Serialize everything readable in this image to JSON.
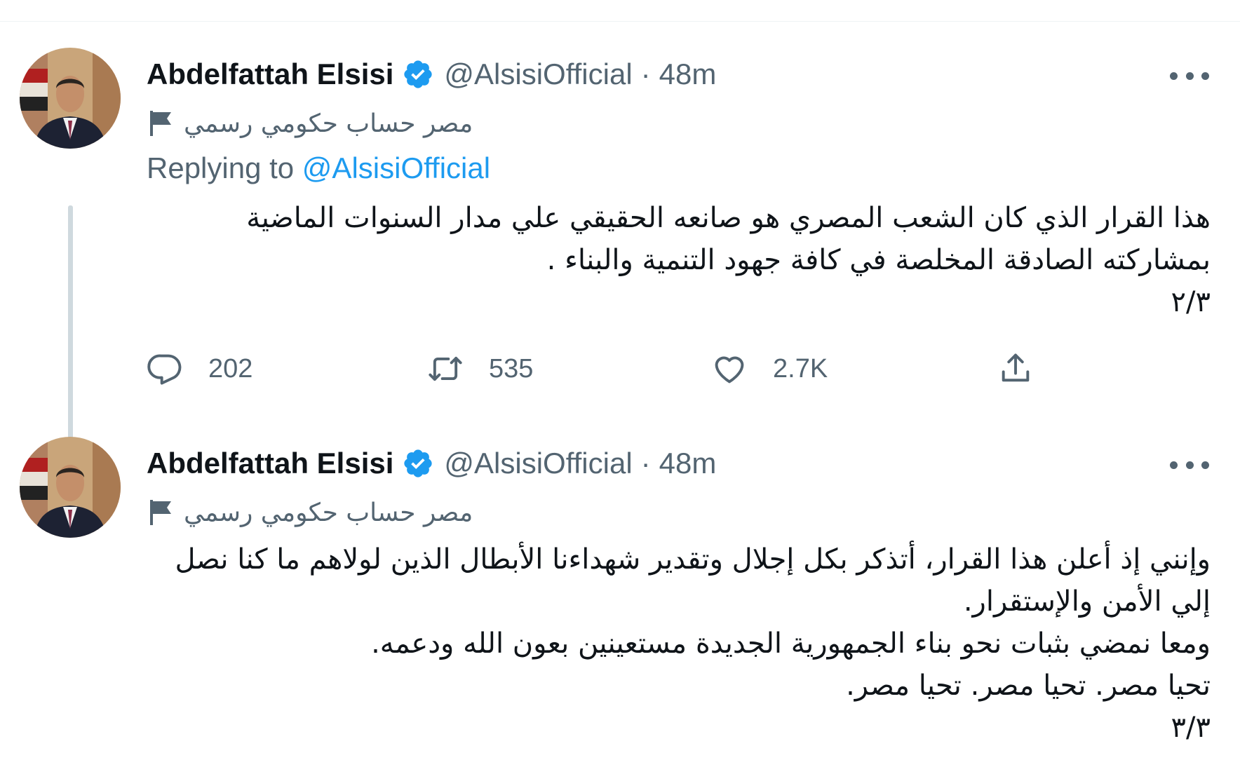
{
  "colors": {
    "verified": "#1d9bf0",
    "link": "#1d9bf0",
    "secondary_text": "#536471",
    "primary_text": "#0f1419",
    "thread_line": "#cfd9de"
  },
  "tweets": [
    {
      "author": {
        "name": "Abdelfattah Elsisi",
        "handle": "@AlsisiOfficial",
        "verified_icon": "verified-badge-icon"
      },
      "separator": "·",
      "time": "48m",
      "label": "مصر حساب حكومي رسمي",
      "replying_prefix": "Replying to",
      "replying_handle": "@AlsisiOfficial",
      "text": "هذا القرار الذي كان  الشعب المصري هو صانعه الحقيقي علي مدار السنوات الماضية بمشاركته الصادقة المخلصة في كافة جهود التنمية والبناء .\n٢/٣",
      "actions": {
        "replies": "202",
        "retweets": "535",
        "likes": "2.7K"
      }
    },
    {
      "author": {
        "name": "Abdelfattah Elsisi",
        "handle": "@AlsisiOfficial",
        "verified_icon": "verified-badge-icon"
      },
      "separator": "·",
      "time": "48m",
      "label": "مصر حساب حكومي رسمي",
      "text": "وإنني إذ أعلن هذا القرار، أتذكر بكل إجلال وتقدير شهداءنا الأبطال الذين لولاهم ما كنا نصل إلي الأمن والإستقرار.\nومعا نمضي بثبات نحو بناء الجمهورية الجديدة مستعينين بعون الله ودعمه.\nتحيا مصر. تحيا مصر. تحيا مصر.\n٣/٣"
    }
  ]
}
